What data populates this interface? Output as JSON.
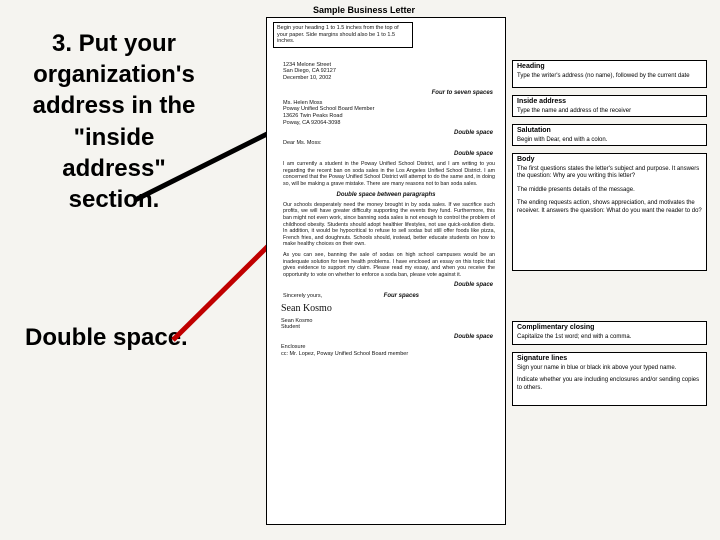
{
  "title": "Sample Business Letter",
  "instruction_main": "3.  Put your organization's address in the \"inside address\" section.",
  "instruction_sub": "Double space.",
  "margin_note": "Begin your heading 1 to 1.5 inches from the top of your paper. Side margins should also be 1 to 1.5 inches.",
  "sender": {
    "street": "1234 Melone Street",
    "city": "San Diego, CA 92127",
    "date": "December 10, 2002"
  },
  "spacer_four_seven": "Four to seven spaces",
  "recipient": {
    "name": "Ms. Helen Moss",
    "org": "Poway Unified School Board Member",
    "street": "13626 Twin Peaks Road",
    "city": "Poway, CA 92064-3098"
  },
  "spacer_double": "Double space",
  "salutation": "Dear Ms. Moss:",
  "para1": "I am currently a student in the Poway Unified School District, and I am writing to you regarding the recent ban on soda sales in the Los Angeles Unified School District. I am concerned that the Poway Unified School District will attempt to do the same and, in doing so, will be making a grave mistake. There are many reasons not to ban soda sales.",
  "spacer_between": "Double space between paragraphs",
  "para2": "Our schools desperately need the money brought in by soda sales. If we sacrifice such profits, we will have greater difficulty supporting the events they fund. Furthermore, this ban might not even work, since banning soda sales is not enough to control the problem of childhood obesity. Students should adopt healthier lifestyles, not use quick-solution diets. In addition, it would be hypocritical to refuse to sell sodas but still offer foods like pizza, French fries, and doughnuts. Schools should, instead, better educate students on how to make healthy choices on their own.",
  "para3": "As you can see, banning the sale of sodas on high school campuses would be an inadequate solution for teen health problems. I have enclosed an essay on this topic that gives evidence to support my claim. Please read my essay, and when you receive the opportunity to vote on whether to enforce a soda ban, please vote against it.",
  "closing": "Sincerely yours,",
  "four_spaces": "Four spaces",
  "signature_script": "Sean Kosmo",
  "signature_name": "Sean Kosmo",
  "signature_title": "Student",
  "enclosure": "Enclosure",
  "cc": "cc: Mr. Lopez, Poway Unified School Board member",
  "callouts": {
    "heading": {
      "title": "Heading",
      "body": "Type the writer's address (no name), followed by the current date"
    },
    "inside": {
      "title": "Inside address",
      "body": "Type the name and address of the receiver"
    },
    "salut": {
      "title": "Salutation",
      "body": "Begin with Dear, end with a colon."
    },
    "body": {
      "title": "Body",
      "p1": "The first questions states the letter's subject and purpose. It answers the question: Why are you writing this letter?",
      "p2": "The middle presents details of the message.",
      "p3": "The ending requests action, shows appreciation, and motivates the receiver. It answers the question: What do you want the reader to do?"
    },
    "close": {
      "title": "Complimentary closing",
      "body": "Capitalize the 1st word; end with a comma."
    },
    "sig": {
      "title": "Signature lines",
      "p1": "Sign your name in blue or black ink above your typed name.",
      "p2": "Indicate whether you are including enclosures and/or sending copies to others."
    }
  }
}
